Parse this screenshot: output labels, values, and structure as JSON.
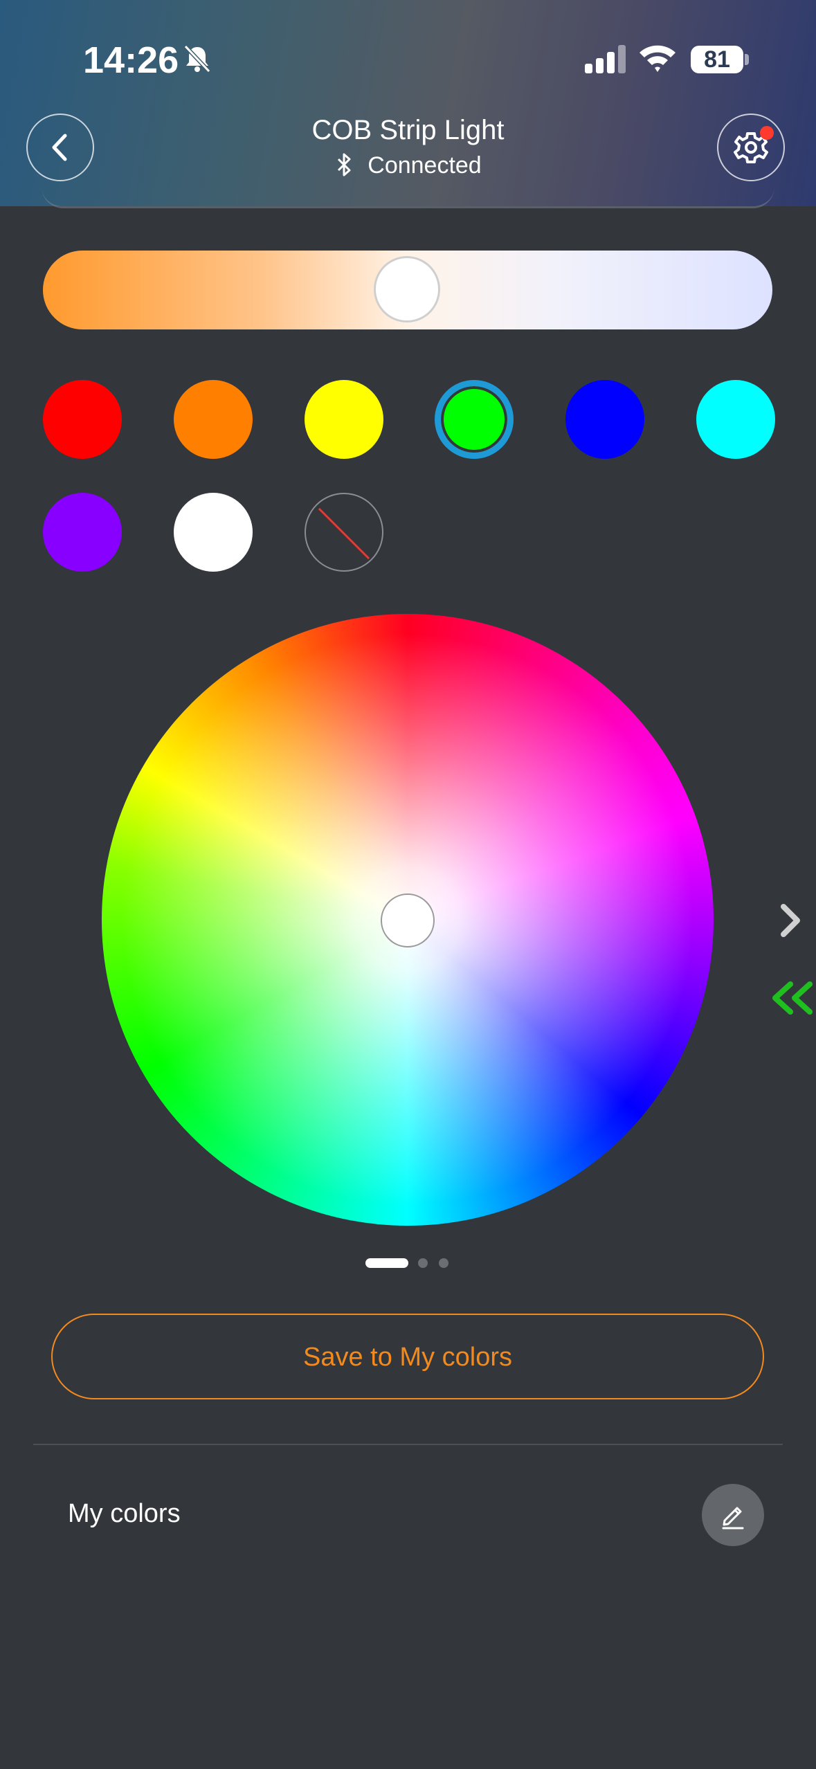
{
  "status_bar": {
    "time": "14:26",
    "battery": "81",
    "icons": [
      "bell-slash-icon",
      "cellular-signal-icon",
      "wifi-icon",
      "battery-icon"
    ]
  },
  "header": {
    "title": "COB Strip Light",
    "status": "Connected",
    "back_icon": "chevron-left-icon",
    "settings_icon": "gear-icon",
    "settings_has_notification": true
  },
  "temperature_slider": {
    "value": 0.5,
    "start_color": "#ff9a2e",
    "end_color": "#dde2ff"
  },
  "preset_colors": [
    {
      "color": "#ff0000",
      "selected": false
    },
    {
      "color": "#ff7f00",
      "selected": false
    },
    {
      "color": "#ffff00",
      "selected": false
    },
    {
      "color": "#00ff00",
      "selected": true
    },
    {
      "color": "#0000ff",
      "selected": false
    },
    {
      "color": "#00ffff",
      "selected": false
    },
    {
      "color": "#8800ff",
      "selected": false
    },
    {
      "color": "#ffffff",
      "selected": false
    },
    {
      "color": "none",
      "selected": false
    }
  ],
  "color_wheel": {
    "selected_color": "#ffffff"
  },
  "pager": {
    "pages": 3,
    "active": 0
  },
  "save_button": {
    "label": "Save to My colors"
  },
  "my_colors": {
    "label": "My colors",
    "edit_icon": "pencil-icon"
  },
  "colors": {
    "accent": "#f28a1e",
    "selection_ring": "#1e9ad6",
    "background": "#33363b",
    "notification": "#ff3b30"
  }
}
